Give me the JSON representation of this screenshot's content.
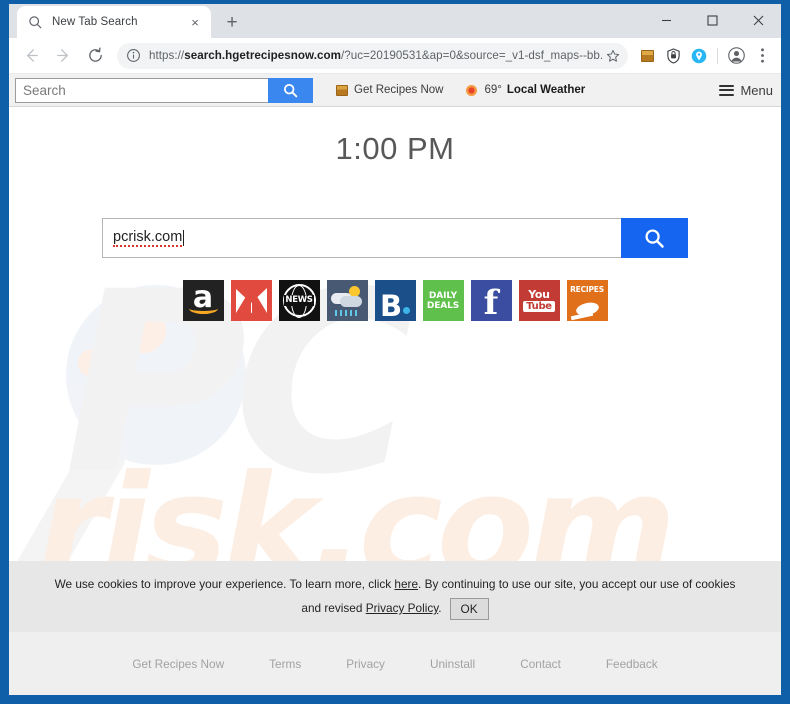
{
  "browser": {
    "tab": {
      "title": "New Tab Search",
      "favicon": "search-icon",
      "close_label": "×"
    },
    "new_tab_label": "+",
    "window_controls": {
      "minimize": "minimize-icon",
      "maximize": "maximize-icon",
      "close": "close-icon"
    },
    "nav": {
      "back": "back-arrow-icon",
      "forward": "forward-arrow-icon",
      "reload": "reload-icon"
    },
    "omnibox": {
      "site_info_icon": "info-circle-icon",
      "scheme": "https://",
      "host": "search.hgetrecipesnow.com",
      "path": "/?uc=20190531&ap=0&source=_v1-dsf_maps--bb...",
      "full_url": "https://search.hgetrecipesnow.com/?uc=20190531&ap=0&source=_v1-dsf_maps--bb...",
      "bookmark_icon": "star-icon"
    },
    "extensions": [
      {
        "name": "box-extension-icon"
      },
      {
        "name": "shield-extension-icon"
      },
      {
        "name": "location-pin-extension-icon"
      }
    ],
    "profile_icon": "profile-avatar-icon",
    "menu_icon": "three-dot-menu-icon"
  },
  "ext_bar": {
    "search_placeholder": "Search",
    "search_value": "",
    "search_button_icon": "magnifier-icon",
    "recipes_link": "Get Recipes Now",
    "weather_temp": "69°",
    "weather_label": "Local Weather",
    "menu_label": "Menu"
  },
  "page": {
    "clock": "1:00 PM",
    "search": {
      "value": "pcrisk.com",
      "placeholder": "",
      "button_icon": "magnifier-icon"
    },
    "watermark": {
      "top": "PC",
      "bottom": "risk.com"
    },
    "quick_links": [
      {
        "name": "amazon",
        "label": "a",
        "color": "#222222"
      },
      {
        "name": "gmail",
        "label": "",
        "color": "#e14b3f"
      },
      {
        "name": "news",
        "label": "NEWS",
        "color": "#111111"
      },
      {
        "name": "weather",
        "label": "",
        "color": "#485a73"
      },
      {
        "name": "booking",
        "label": "B.",
        "color": "#1a4f8a"
      },
      {
        "name": "deals",
        "label": "DAILY DEALS",
        "color": "#5fc14c"
      },
      {
        "name": "facebook",
        "label": "f",
        "color": "#3a4da0"
      },
      {
        "name": "youtube",
        "label": "You Tube",
        "color": "#c23b35"
      },
      {
        "name": "recipes",
        "label": "RECIPES",
        "color": "#e0701a"
      }
    ],
    "deals_line1": "DAILY",
    "deals_line2": "DEALS",
    "yt_line1": "You",
    "yt_line2": "Tube",
    "recipes_word": "RECIPES",
    "news_word": "NEWS",
    "booking_letter": "B",
    "fb_letter": "f",
    "amazon_letter": "a"
  },
  "cookie_banner": {
    "text_part1": "We use cookies to improve your experience. To learn more, click ",
    "here_link": "here",
    "text_part2": ". By continuing to use our site, you accept our use of cookies",
    "text_part3": "and revised ",
    "privacy_link": "Privacy Policy",
    "text_part4": ".",
    "ok_label": "OK"
  },
  "footer": {
    "links": [
      "Get Recipes Now",
      "Terms",
      "Privacy",
      "Uninstall",
      "Contact",
      "Feedback"
    ]
  },
  "colors": {
    "window_border": "#0e5ea8",
    "tabstrip": "#dee1e6",
    "ext_bar": "#f1f1f1",
    "ext_search_button": "#3b87f0",
    "main_search_button": "#1565f0",
    "cookie_banner": "#e7e7e7",
    "footer": "#efefef",
    "watermark_top": "#f2f2f2",
    "watermark_bottom": "#fdeee4"
  }
}
